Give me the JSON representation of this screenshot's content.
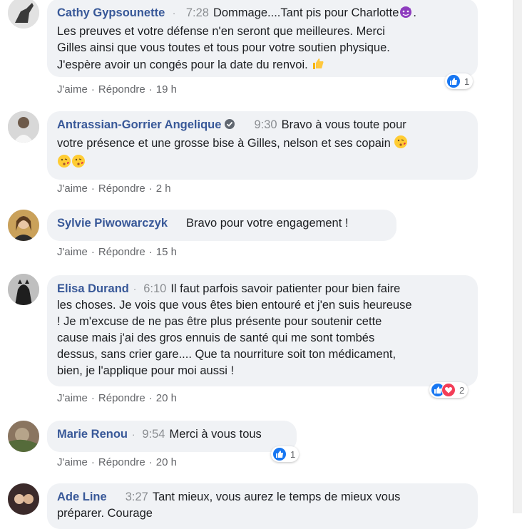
{
  "actions": {
    "like": "J'aime",
    "reply": "Répondre"
  },
  "comments": [
    {
      "author": "Cathy Gypsounette",
      "time": "7:28",
      "lines": [
        "Dommage....Tant pis pour Charlotte",
        "Les preuves et votre défense n'en seront que meilleures. Merci",
        "Gilles ainsi que vous toutes et tous pour votre soutien physique.",
        "J'espère avoir un congés pour la date du renvoi."
      ],
      "age": "19 h",
      "reaction_count": "1"
    },
    {
      "author": "Antrassian-Gorrier Angelique",
      "time": "9:30",
      "lines": [
        "Bravo à vous toute pour",
        "votre présence et une grosse bise à Gilles, nelson et ses copain"
      ],
      "age": "2 h"
    },
    {
      "author": "Sylvie Piwowarczyk",
      "time": "",
      "lines": [
        "Bravo pour votre engagement !"
      ],
      "age": "15 h"
    },
    {
      "author": "Elisa Durand",
      "time": "6:10",
      "lines": [
        "Il faut parfois savoir patienter pour bien faire",
        "les choses. Je vois que vous êtes bien entouré et j'en suis heureuse",
        "! Je m'excuse de ne pas être plus présente pour soutenir cette",
        "cause mais j'ai des gros ennuis de santé qui me sont tombés",
        "dessus, sans crier gare.... Que ta nourriture soit ton médicament,",
        "bien, je l'applique pour moi aussi !"
      ],
      "age": "20 h",
      "reaction_count": "2"
    },
    {
      "author": "Marie Renou",
      "time": "9:54",
      "lines": [
        "Merci à vous tous"
      ],
      "age": "20 h",
      "reaction_count": "1"
    },
    {
      "author": "Ade Line",
      "time": "3:27",
      "lines": [
        "Tant mieux, vous aurez le temps de mieux vous",
        "préparer. Courage"
      ]
    }
  ],
  "colors": {
    "author": "#385898",
    "bubble": "#f0f2f5",
    "like": "#1877f2",
    "love": "#f33e58"
  },
  "icons": [
    "thumbs-up-reaction-icon",
    "heart-reaction-icon",
    "devil-emoji-icon",
    "thumbs-up-emoji-icon",
    "kiss-emoji-icon",
    "verified-badge-icon"
  ]
}
